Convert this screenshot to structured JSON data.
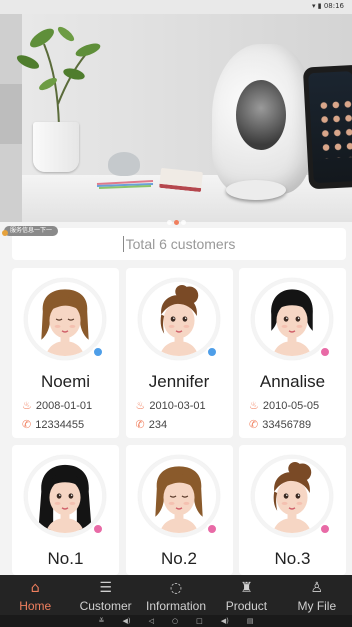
{
  "status_bar": {
    "icons": "▾ ▮ 08:16"
  },
  "banner": {
    "promo_tag": "服务信息一下一",
    "pager": [
      false,
      true,
      false
    ]
  },
  "summary": {
    "total_text": "Total 6 customers"
  },
  "customers": [
    {
      "name": "Noemi",
      "birthday": "2008-01-01",
      "phone": "12334455",
      "badge": "blue",
      "hair": "brown",
      "eyes": "closed"
    },
    {
      "name": "Jennifer",
      "birthday": "2010-03-01",
      "phone": "234",
      "badge": "blue",
      "hair": "brown-updo",
      "eyes": "open"
    },
    {
      "name": "Annalise",
      "birthday": "2010-05-05",
      "phone": "33456789",
      "badge": "pink",
      "hair": "black",
      "eyes": "open"
    },
    {
      "name": "No.1",
      "badge": "pink",
      "hair": "black-long",
      "eyes": "open"
    },
    {
      "name": "No.2",
      "badge": "pink",
      "hair": "brown",
      "eyes": "closed"
    },
    {
      "name": "No.3",
      "badge": "pink",
      "hair": "brown-updo",
      "eyes": "open"
    }
  ],
  "tabs": [
    {
      "label": "Home",
      "icon": "home-icon",
      "glyph": "⌂",
      "active": true
    },
    {
      "label": "Customer",
      "icon": "list-icon",
      "glyph": "☰",
      "active": false
    },
    {
      "label": "Information",
      "icon": "chat-icon",
      "glyph": "◌",
      "active": false
    },
    {
      "label": "Product",
      "icon": "bag-icon",
      "glyph": "♜",
      "active": false
    },
    {
      "label": "My File",
      "icon": "person-icon",
      "glyph": "♙",
      "active": false
    }
  ],
  "sysnav": [
    "≚",
    "◀)",
    "◁",
    "○",
    "□",
    "◀)",
    "▤"
  ],
  "colors": {
    "accent": "#f07f5e",
    "tabbar": "#242424",
    "badge_blue": "#4e9ee8",
    "badge_pink": "#e86aa6"
  }
}
